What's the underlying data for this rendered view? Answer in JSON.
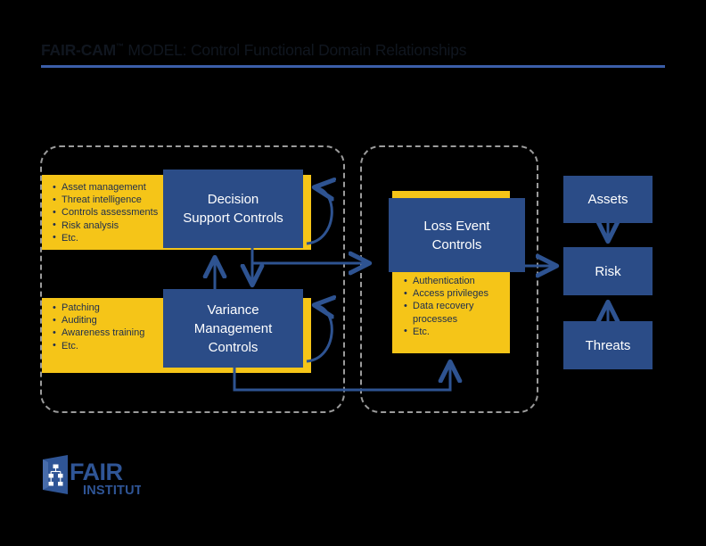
{
  "header": {
    "title_strong": "FAIR-CAM",
    "title_tm": "™",
    "title_rest": " MODEL: Control Functional Domain Relationships",
    "title_full": "FAIR-CAM™ MODEL: Control Functional Domain Relationships",
    "rule_color": "#3b5ea8",
    "title_color": "#10161f"
  },
  "palette": {
    "background": "#000000",
    "navy": "#2B4C87",
    "yellow": "#F5C518",
    "arrow_blue": "#2E5391",
    "dashed_border": "#9b9b9b",
    "navy_text": "#1d2d4e",
    "white_text": "#ffffff"
  },
  "panels": [
    {
      "id": "panel-left",
      "name": "left-control-domain-panel"
    },
    {
      "id": "panel-right",
      "name": "right-control-domain-panel"
    }
  ],
  "boxes": {
    "decision_support": {
      "label_line1": "Decision",
      "label_line2": "Support Controls",
      "examples": [
        "Asset management",
        "Threat intelligence",
        "Controls assessments",
        "Risk analysis",
        "Etc."
      ]
    },
    "variance_management": {
      "label_line1": "Variance",
      "label_line2": "Management",
      "label_line3": "Controls",
      "examples": [
        "Patching",
        "Auditing",
        "Awareness training",
        "Etc."
      ]
    },
    "loss_event": {
      "label_line1": "Loss Event",
      "label_line2": "Controls",
      "examples": [
        "Authentication",
        "Access privileges",
        "Data recovery",
        "processes",
        "Etc."
      ]
    },
    "assets": {
      "label": "Assets"
    },
    "risk": {
      "label": "Risk"
    },
    "threats": {
      "label": "Threats"
    }
  },
  "logo": {
    "word_primary": "FAIR",
    "word_secondary": "INSTITUTE",
    "mark_color": "#2f5596",
    "text_color": "#2f5596"
  },
  "connections": [
    {
      "name": "variance-to-decision-support",
      "from": "variance_management",
      "to": "decision_support",
      "direction": "up"
    },
    {
      "name": "decision-support-to-variance",
      "from": "decision_support",
      "to": "variance_management",
      "direction": "down"
    },
    {
      "name": "decision-support-to-loss-event",
      "from": "decision_support",
      "to": "loss_event",
      "direction": "right"
    },
    {
      "name": "variance-to-loss-event",
      "from": "variance_management",
      "to": "loss_event",
      "direction": "right-up"
    },
    {
      "name": "loss-event-to-risk",
      "from": "loss_event",
      "to": "risk",
      "direction": "right"
    },
    {
      "name": "assets-to-risk",
      "from": "assets",
      "to": "risk",
      "direction": "down"
    },
    {
      "name": "threats-to-risk",
      "from": "threats",
      "to": "risk",
      "direction": "up"
    },
    {
      "name": "decision-support-self-loop",
      "from": "decision_support",
      "to": "decision_support",
      "direction": "loop"
    },
    {
      "name": "variance-self-loop",
      "from": "variance_management",
      "to": "variance_management",
      "direction": "loop"
    }
  ]
}
